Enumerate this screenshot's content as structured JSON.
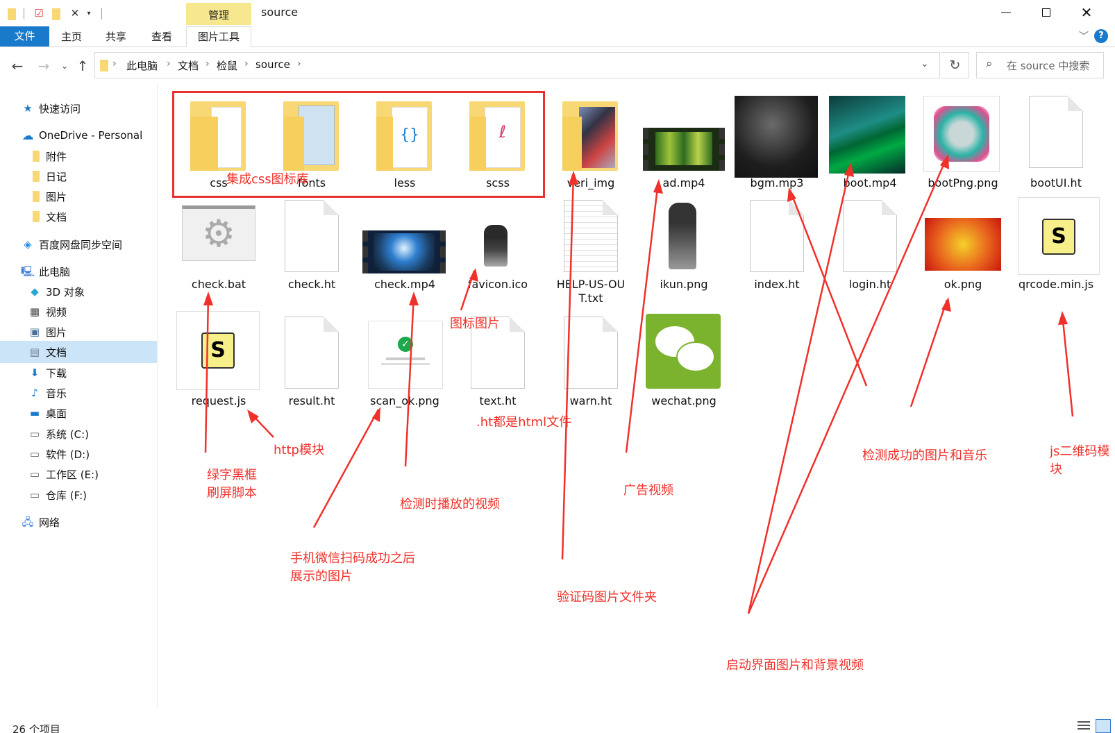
{
  "titlebar": {
    "context_tab": "管理",
    "window_title": "source",
    "min_icon": "minimize-icon",
    "max_icon": "maximize-icon",
    "close_icon": "close-icon"
  },
  "ribbon": {
    "file_tab": "文件",
    "tabs": [
      "主页",
      "共享",
      "查看"
    ],
    "tools_tab": "图片工具"
  },
  "address": {
    "crumbs": [
      "此电脑",
      "文档",
      "检鼠",
      "source"
    ],
    "search_placeholder": "在 source 中搜索"
  },
  "nav": {
    "quick_access": "快速访问",
    "onedrive": "OneDrive - Personal",
    "onedrive_children": [
      "附件",
      "日记",
      "图片",
      "文档"
    ],
    "baidu": "百度网盘同步空间",
    "this_pc": "此电脑",
    "pc_children": [
      "3D 对象",
      "视频",
      "图片",
      "文档",
      "下载",
      "音乐",
      "桌面",
      "系统 (C:)",
      "软件 (D:)",
      "工作区 (E:)",
      "仓库 (F:)"
    ],
    "network": "网络",
    "selected": "文档"
  },
  "files": [
    {
      "name": "css",
      "type": "folder"
    },
    {
      "name": "fonts",
      "type": "folder"
    },
    {
      "name": "less",
      "type": "folder"
    },
    {
      "name": "scss",
      "type": "folder"
    },
    {
      "name": "veri_img",
      "type": "folder"
    },
    {
      "name": "ad.mp4",
      "type": "video"
    },
    {
      "name": "bgm.mp3",
      "type": "image"
    },
    {
      "name": "boot.mp4",
      "type": "image"
    },
    {
      "name": "bootPng.png",
      "type": "image"
    },
    {
      "name": "bootUI.ht",
      "type": "doc"
    },
    {
      "name": "check.bat",
      "type": "bat"
    },
    {
      "name": "check.ht",
      "type": "doc"
    },
    {
      "name": "check.mp4",
      "type": "video"
    },
    {
      "name": "favicon.ico",
      "type": "image"
    },
    {
      "name": "HELP-US-OUT.txt",
      "type": "txt"
    },
    {
      "name": "ikun.png",
      "type": "image"
    },
    {
      "name": "index.ht",
      "type": "doc"
    },
    {
      "name": "login.ht",
      "type": "doc"
    },
    {
      "name": "ok.png",
      "type": "image"
    },
    {
      "name": "qrcode.min.js",
      "type": "js"
    },
    {
      "name": "request.js",
      "type": "js"
    },
    {
      "name": "result.ht",
      "type": "doc"
    },
    {
      "name": "scan_ok.png",
      "type": "image"
    },
    {
      "name": "text.ht",
      "type": "doc"
    },
    {
      "name": "warn.ht",
      "type": "doc"
    },
    {
      "name": "wechat.png",
      "type": "image"
    }
  ],
  "annotations": {
    "css_lib": "集成css图标库",
    "icon_image": "图标图片",
    "ht_note": ".ht都是html文件",
    "http_module": "http模块",
    "green_text": "绿字黑框\n刷屏脚本",
    "check_video": "检测时播放的视频",
    "scan_image": "手机微信扫码成功之后\n展示的图片",
    "veri_folder": "验证码图片文件夹",
    "ad_video": "广告视频",
    "success_media": "检测成功的图片和音乐",
    "qrcode_module": "js二维码模\n块",
    "boot_media": "启动界面图片和背景视频"
  },
  "status": {
    "count": "26 个项目"
  },
  "colors": {
    "accent": "#1979ca",
    "annotation": "#f0302a",
    "context_tab": "#f7e88f"
  }
}
